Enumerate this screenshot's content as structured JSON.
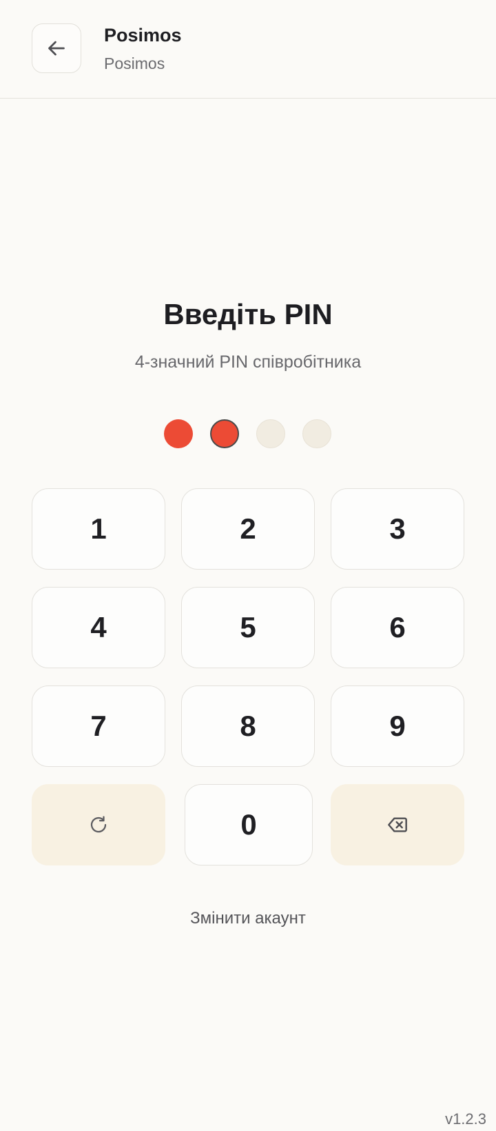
{
  "header": {
    "title": "Posimos",
    "subtitle": "Posimos",
    "back_icon": "arrow-left-icon"
  },
  "pin": {
    "title": "Введіть PIN",
    "subtitle": "4-значний PIN співробітника",
    "length": 4,
    "entered": 2
  },
  "keypad": {
    "keys": [
      "1",
      "2",
      "3",
      "4",
      "5",
      "6",
      "7",
      "8",
      "9",
      "0"
    ],
    "refresh_icon": "refresh-icon",
    "backspace_icon": "backspace-icon"
  },
  "footer": {
    "switch_account": "Змінити акаунт",
    "version": "v1.2.3"
  },
  "colors": {
    "accent": "#ec4b35",
    "action_key_bg": "#f8f1e2",
    "empty_dot": "#f1ece1"
  }
}
